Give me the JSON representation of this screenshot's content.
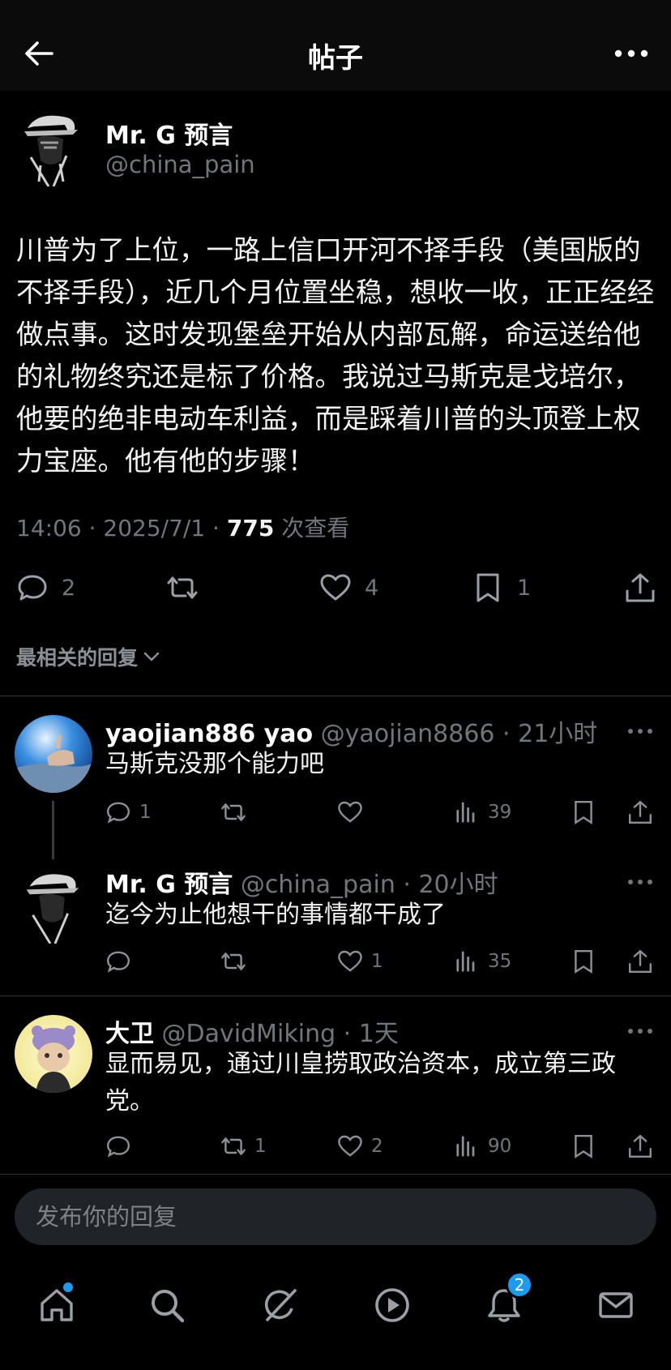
{
  "header": {
    "title": "帖子"
  },
  "post": {
    "author_name": "Mr. G 预言",
    "author_handle": "@china_pain",
    "text": "川普为了上位，一路上信口开河不择手段（美国版的不择手段），近几个月位置坐稳，想收一收，正正经经做点事。这时发现堡垒开始从内部瓦解，命运送给他的礼物终究还是标了价格。我说过马斯克是戈培尔，他要的绝非电动车利益，而是踩着川普的头顶登上权力宝座。他有他的步骤！",
    "time": "14:06 · 2025/7/1 · ",
    "views": "775",
    "views_label": " 次查看",
    "stats": {
      "replies": "2",
      "reposts": "",
      "likes": "4",
      "bookmarks": "1"
    }
  },
  "sort_label": "最相关的回复",
  "replies": [
    {
      "name": "yaojian886 yao",
      "handle": " @yaojian8866 · 21小时",
      "text": "马斯克没那个能力吧",
      "replies": "1",
      "reposts": "",
      "likes": "",
      "views": "39"
    },
    {
      "name": "Mr. G 预言",
      "handle": " @china_pain · 20小时",
      "text": "迄今为止他想干的事情都干成了",
      "replies": "",
      "reposts": "",
      "likes": "1",
      "views": "35"
    },
    {
      "name": "大卫",
      "handle": " @DavidMiking · 1天",
      "text": "显而易见，通过川皇捞取政治资本，成立第三政党。",
      "replies": "",
      "reposts": "1",
      "likes": "2",
      "views": "90"
    }
  ],
  "composer": {
    "placeholder": "发布你的回复"
  },
  "tabbar": {
    "notifications_badge": "2"
  },
  "colors": {
    "background": "#000000",
    "muted": "#71767b",
    "accent": "#1d9bf0"
  },
  "icons": [
    "back-arrow-icon",
    "more-icon",
    "reply-icon",
    "repost-icon",
    "like-icon",
    "bookmark-icon",
    "share-icon",
    "views-icon",
    "home-icon",
    "search-icon",
    "grok-icon",
    "video-icon",
    "bell-icon",
    "mail-icon"
  ]
}
